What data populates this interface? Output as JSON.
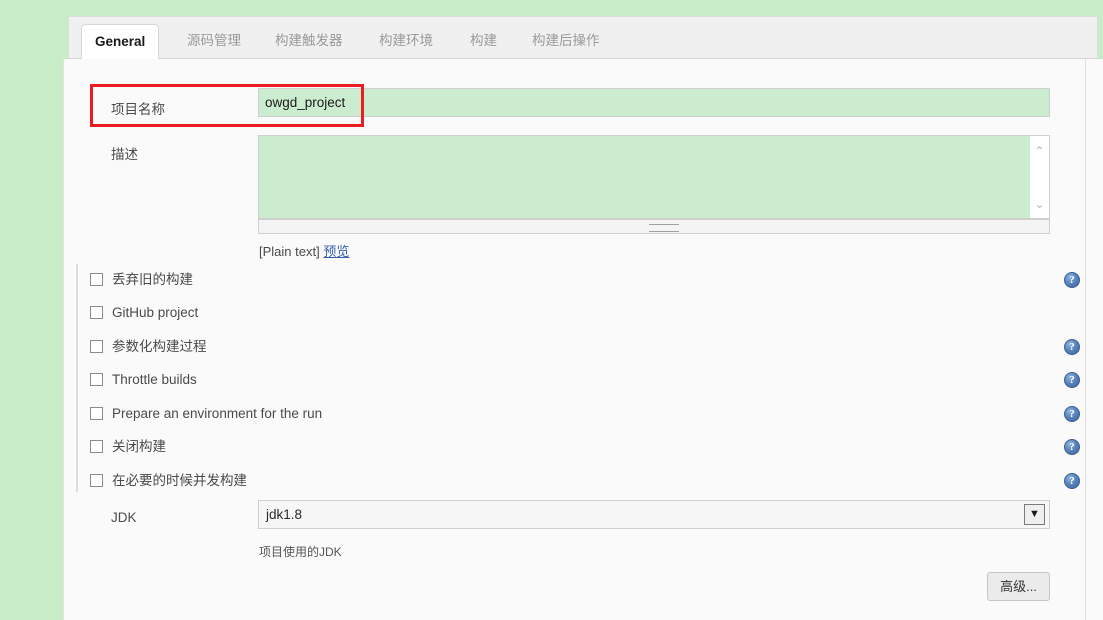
{
  "tabs": [
    {
      "id": "general",
      "label": "General",
      "active": true
    },
    {
      "id": "scm",
      "label": "源码管理",
      "active": false
    },
    {
      "id": "triggers",
      "label": "构建触发器",
      "active": false
    },
    {
      "id": "environment",
      "label": "构建环境",
      "active": false
    },
    {
      "id": "build",
      "label": "构建",
      "active": false
    },
    {
      "id": "post-build",
      "label": "构建后操作",
      "active": false
    }
  ],
  "form": {
    "project_name": {
      "label": "项目名称",
      "value": "owgd_project"
    },
    "description": {
      "label": "描述",
      "value": "",
      "markup_type": "[Plain text]",
      "preview_link": "预览"
    },
    "jdk": {
      "label": "JDK",
      "value": "jdk1.8",
      "help_text": "项目使用的JDK"
    }
  },
  "checkboxes": [
    {
      "id": "discard-old-builds",
      "label": "丢弃旧的构建",
      "checked": false,
      "has_help": true
    },
    {
      "id": "github-project",
      "label": "GitHub project",
      "checked": false,
      "has_help": false
    },
    {
      "id": "parameterized-build",
      "label": "参数化构建过程",
      "checked": false,
      "has_help": true
    },
    {
      "id": "throttle-builds",
      "label": "Throttle builds",
      "checked": false,
      "has_help": true
    },
    {
      "id": "prepare-environment",
      "label": "Prepare an environment for the run",
      "checked": false,
      "has_help": true
    },
    {
      "id": "disable-build",
      "label": "关闭构建",
      "checked": false,
      "has_help": true
    },
    {
      "id": "concurrent-builds",
      "label": "在必要的时候并发构建",
      "checked": false,
      "has_help": true
    }
  ],
  "buttons": {
    "advanced": "高级..."
  },
  "icons": {
    "help": "?",
    "scroll_up": "⌃",
    "scroll_down": "⌄",
    "dropdown_arrow": "▼"
  },
  "colors": {
    "page_background": "#c8ecc8",
    "panel_background": "#fafafa",
    "autofill_field": "#ccecd0",
    "highlight_box": "#ec1c24",
    "link": "#3a5fb0",
    "help_icon": "#3c63a0"
  }
}
